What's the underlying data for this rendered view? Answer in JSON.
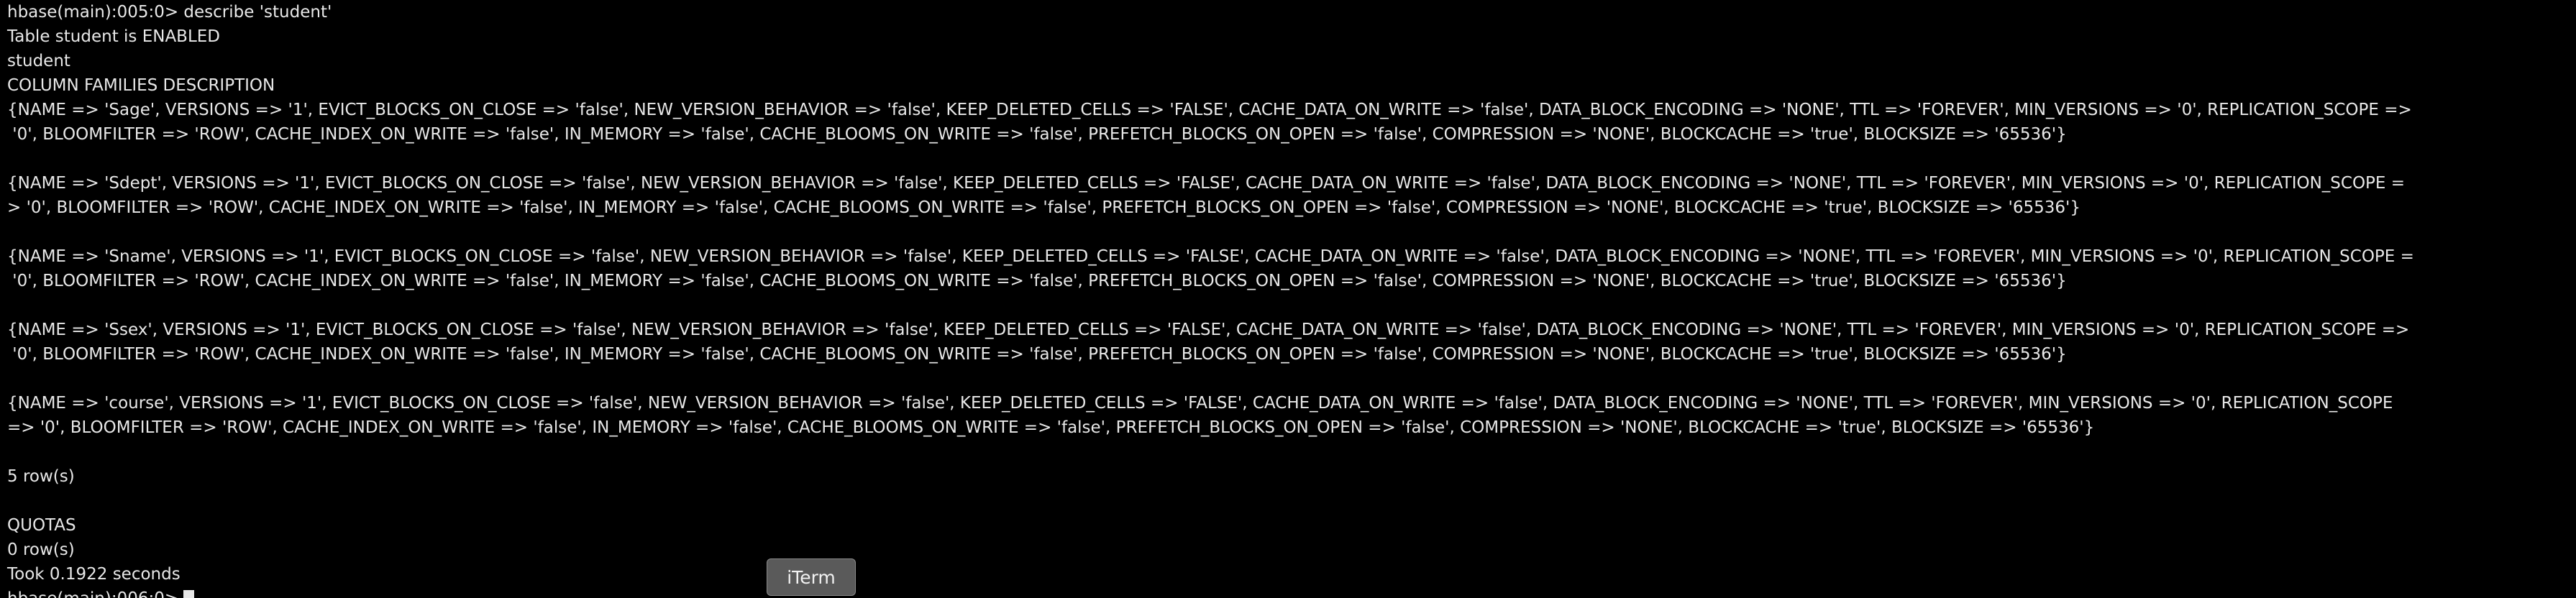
{
  "terminal": {
    "lines": [
      "hbase(main):005:0> describe 'student'",
      "Table student is ENABLED",
      "student",
      "COLUMN FAMILIES DESCRIPTION",
      "{NAME => 'Sage', VERSIONS => '1', EVICT_BLOCKS_ON_CLOSE => 'false', NEW_VERSION_BEHAVIOR => 'false', KEEP_DELETED_CELLS => 'FALSE', CACHE_DATA_ON_WRITE => 'false', DATA_BLOCK_ENCODING => 'NONE', TTL => 'FOREVER', MIN_VERSIONS => '0', REPLICATION_SCOPE =>",
      " '0', BLOOMFILTER => 'ROW', CACHE_INDEX_ON_WRITE => 'false', IN_MEMORY => 'false', CACHE_BLOOMS_ON_WRITE => 'false', PREFETCH_BLOCKS_ON_OPEN => 'false', COMPRESSION => 'NONE', BLOCKCACHE => 'true', BLOCKSIZE => '65536'}",
      "",
      "{NAME => 'Sdept', VERSIONS => '1', EVICT_BLOCKS_ON_CLOSE => 'false', NEW_VERSION_BEHAVIOR => 'false', KEEP_DELETED_CELLS => 'FALSE', CACHE_DATA_ON_WRITE => 'false', DATA_BLOCK_ENCODING => 'NONE', TTL => 'FOREVER', MIN_VERSIONS => '0', REPLICATION_SCOPE =",
      "> '0', BLOOMFILTER => 'ROW', CACHE_INDEX_ON_WRITE => 'false', IN_MEMORY => 'false', CACHE_BLOOMS_ON_WRITE => 'false', PREFETCH_BLOCKS_ON_OPEN => 'false', COMPRESSION => 'NONE', BLOCKCACHE => 'true', BLOCKSIZE => '65536'}",
      "",
      "{NAME => 'Sname', VERSIONS => '1', EVICT_BLOCKS_ON_CLOSE => 'false', NEW_VERSION_BEHAVIOR => 'false', KEEP_DELETED_CELLS => 'FALSE', CACHE_DATA_ON_WRITE => 'false', DATA_BLOCK_ENCODING => 'NONE', TTL => 'FOREVER', MIN_VERSIONS => '0', REPLICATION_SCOPE =",
      " '0', BLOOMFILTER => 'ROW', CACHE_INDEX_ON_WRITE => 'false', IN_MEMORY => 'false', CACHE_BLOOMS_ON_WRITE => 'false', PREFETCH_BLOCKS_ON_OPEN => 'false', COMPRESSION => 'NONE', BLOCKCACHE => 'true', BLOCKSIZE => '65536'}",
      "",
      "{NAME => 'Ssex', VERSIONS => '1', EVICT_BLOCKS_ON_CLOSE => 'false', NEW_VERSION_BEHAVIOR => 'false', KEEP_DELETED_CELLS => 'FALSE', CACHE_DATA_ON_WRITE => 'false', DATA_BLOCK_ENCODING => 'NONE', TTL => 'FOREVER', MIN_VERSIONS => '0', REPLICATION_SCOPE =>",
      " '0', BLOOMFILTER => 'ROW', CACHE_INDEX_ON_WRITE => 'false', IN_MEMORY => 'false', CACHE_BLOOMS_ON_WRITE => 'false', PREFETCH_BLOCKS_ON_OPEN => 'false', COMPRESSION => 'NONE', BLOCKCACHE => 'true', BLOCKSIZE => '65536'}",
      "",
      "{NAME => 'course', VERSIONS => '1', EVICT_BLOCKS_ON_CLOSE => 'false', NEW_VERSION_BEHAVIOR => 'false', KEEP_DELETED_CELLS => 'FALSE', CACHE_DATA_ON_WRITE => 'false', DATA_BLOCK_ENCODING => 'NONE', TTL => 'FOREVER', MIN_VERSIONS => '0', REPLICATION_SCOPE",
      "=> '0', BLOOMFILTER => 'ROW', CACHE_INDEX_ON_WRITE => 'false', IN_MEMORY => 'false', CACHE_BLOOMS_ON_WRITE => 'false', PREFETCH_BLOCKS_ON_OPEN => 'false', COMPRESSION => 'NONE', BLOCKCACHE => 'true', BLOCKSIZE => '65536'}",
      "",
      "5 row(s)",
      "",
      "QUOTAS",
      "0 row(s)",
      "Took 0.1922 seconds"
    ],
    "prompt": "hbase(main):006:0> "
  },
  "tooltip": {
    "label": "iTerm"
  }
}
